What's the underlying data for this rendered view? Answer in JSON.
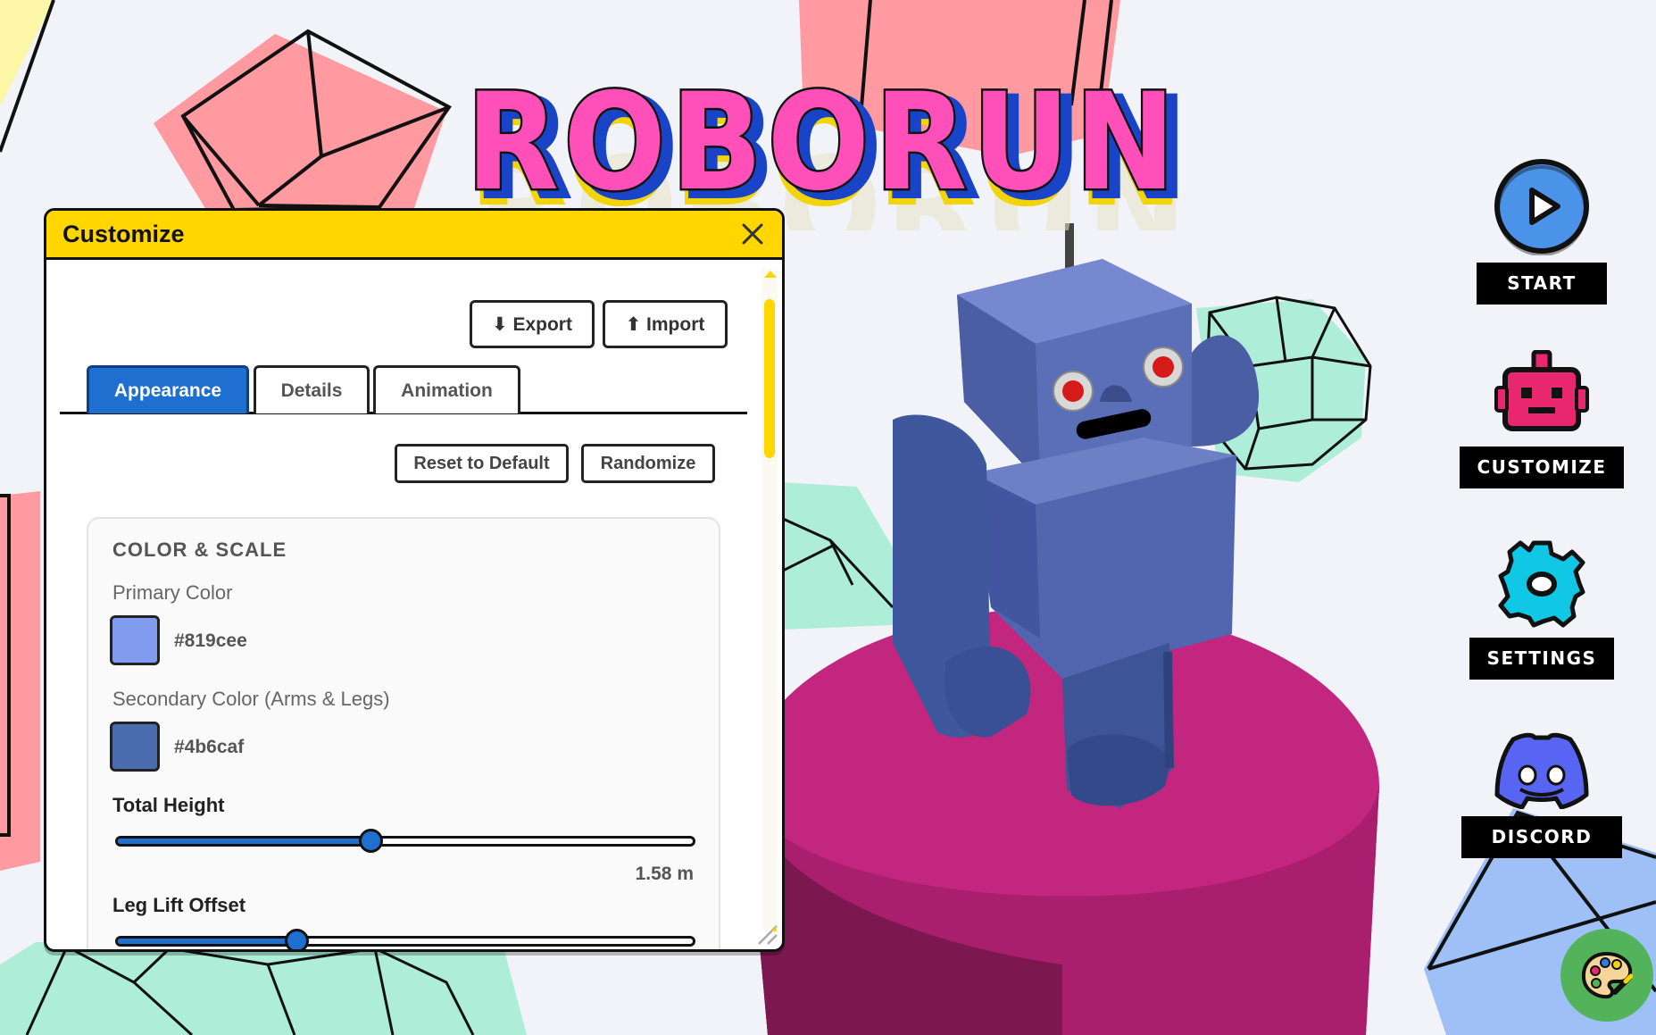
{
  "game_title": "ROBORUN",
  "menu": [
    {
      "id": "start",
      "label": "START",
      "icon": "play-icon"
    },
    {
      "id": "customize",
      "label": "CUSTOMIZE",
      "icon": "robot-head-icon"
    },
    {
      "id": "settings",
      "label": "SETTINGS",
      "icon": "gear-icon"
    },
    {
      "id": "discord",
      "label": "DISCORD",
      "icon": "discord-icon"
    }
  ],
  "palette_button": {
    "icon": "palette-icon"
  },
  "panel": {
    "title": "Customize",
    "close_icon": "close-icon",
    "export_label": "⬇ Export",
    "import_label": "⬆ Import",
    "tabs": [
      {
        "label": "Appearance",
        "active": true
      },
      {
        "label": "Details",
        "active": false
      },
      {
        "label": "Animation",
        "active": false
      }
    ],
    "reset_label": "Reset to Default",
    "randomize_label": "Randomize",
    "section": {
      "title": "COLOR & SCALE",
      "primary_label": "Primary Color",
      "primary_hex": "#819cee",
      "secondary_label": "Secondary Color (Arms & Legs)",
      "secondary_hex": "#4b6caf",
      "height_label": "Total Height",
      "height_value": "1.58 m",
      "height_fraction": 0.44,
      "leg_lift_label": "Leg Lift Offset",
      "leg_lift_fraction": 0.31
    }
  },
  "colors": {
    "accent_yellow": "#ffd600",
    "tab_blue": "#1e6fd0",
    "title_pink": "#ff4fb8",
    "title_blue": "#1a44c8",
    "pedestal": "#c2267f",
    "robot_body": "#5a6fb6"
  }
}
